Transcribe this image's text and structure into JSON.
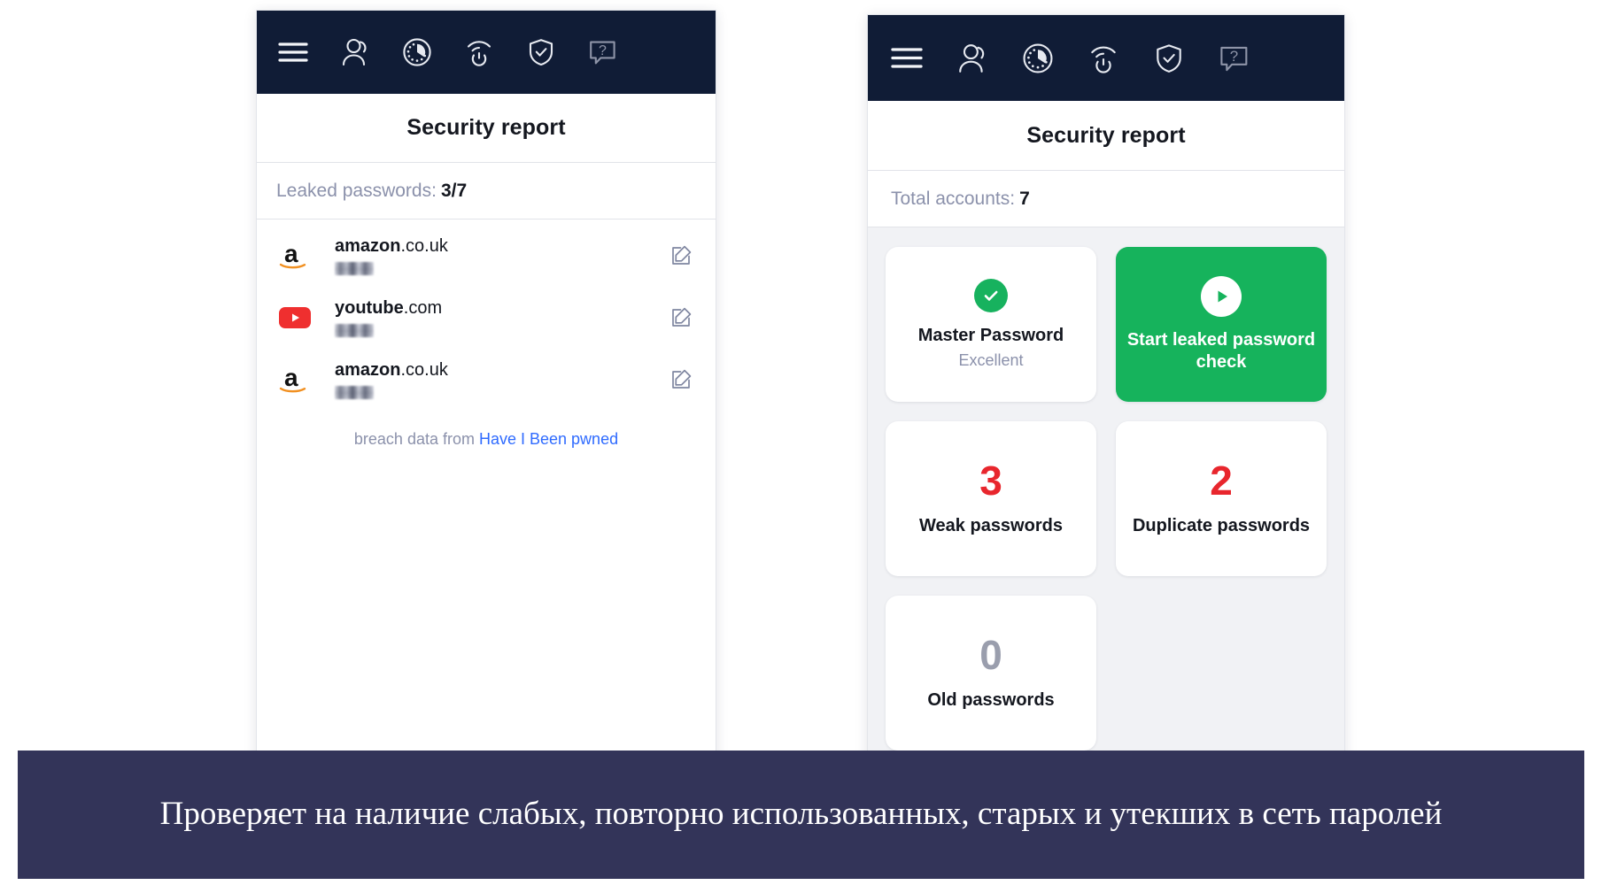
{
  "appbar": {
    "icons": [
      {
        "name": "hamburger-menu-icon",
        "label": "Menu"
      },
      {
        "name": "user-account-icon",
        "label": "My account"
      },
      {
        "name": "dashboard-gauge-icon",
        "label": "Dashboard"
      },
      {
        "name": "vpn-power-icon",
        "label": "VPN"
      },
      {
        "name": "shield-check-icon",
        "label": "Security"
      },
      {
        "name": "help-question-icon",
        "label": "Help"
      }
    ]
  },
  "left_panel": {
    "title": "Security report",
    "summary_label": "Leaked passwords:",
    "summary_value": "3/7",
    "leaks": [
      {
        "logo": "amazon-logo-icon",
        "domain_bold": "amazon",
        "domain_rest": ".co.uk",
        "username": "",
        "edit_label": "Edit"
      },
      {
        "logo": "youtube-logo-icon",
        "domain_bold": "youtube",
        "domain_rest": ".com",
        "username": "",
        "edit_label": "Edit"
      },
      {
        "logo": "amazon-logo-icon",
        "domain_bold": "amazon",
        "domain_rest": ".co.uk",
        "username": "",
        "edit_label": "Edit"
      }
    ],
    "breach_prefix": "breach data from ",
    "breach_link": "Have I Been pwned"
  },
  "right_panel": {
    "title": "Security report",
    "summary_label": "Total accounts:",
    "summary_value": "7",
    "tiles": [
      {
        "kind": "status",
        "icon": "check-circle-icon",
        "label": "Master Password",
        "sub": "Excellent"
      },
      {
        "kind": "action",
        "icon": "play-circle-icon",
        "label": "Start leaked password check"
      },
      {
        "kind": "count",
        "count": "3",
        "count_color": "red",
        "label": "Weak passwords"
      },
      {
        "kind": "count",
        "count": "2",
        "count_color": "red",
        "label": "Duplicate passwords"
      },
      {
        "kind": "count",
        "count": "0",
        "count_color": "grey",
        "label": "Old passwords"
      }
    ]
  },
  "caption": {
    "text": "Проверяет на наличие слабых, повторно использованных, старых и утекших в сеть паролей"
  },
  "colors": {
    "appbar_background": "#101c36",
    "accent_green": "#16b35c",
    "danger_red": "#e8262d",
    "neutral_grey": "#9a9ead",
    "link_blue": "#2f6bff",
    "caption_background": "#333459",
    "tile_area_background": "#f1f2f5"
  }
}
